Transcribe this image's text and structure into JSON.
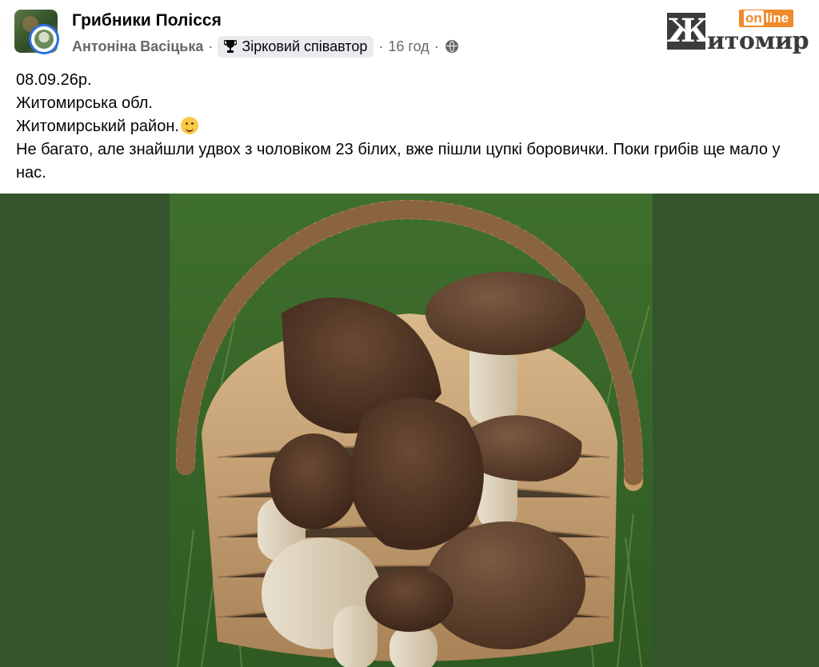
{
  "post": {
    "group_name": "Грибники Полісся",
    "author": "Антоніна Васіцька",
    "separator": "·",
    "badge": "Зірковий співавтор",
    "time": "16 год",
    "audience_icon": "globe-icon",
    "badge_icon": "trophy-icon",
    "lines": [
      "08.09.26р.",
      "Житомирська обл.",
      "Житомирський район.",
      "Не багато, але знайшли удвох з чоловіком 23 білих, вже пішли цупкі боровички. Поки грибів ще мало у нас."
    ]
  },
  "watermark": {
    "online": "online",
    "online_on": "on",
    "online_rest": "line",
    "zh": "Ж",
    "word": "итомир"
  },
  "colors": {
    "media_bg": "#33542c",
    "badge_bg": "#e9ebee",
    "meta_text": "#65676b",
    "logo_orange": "#f08a2b"
  }
}
